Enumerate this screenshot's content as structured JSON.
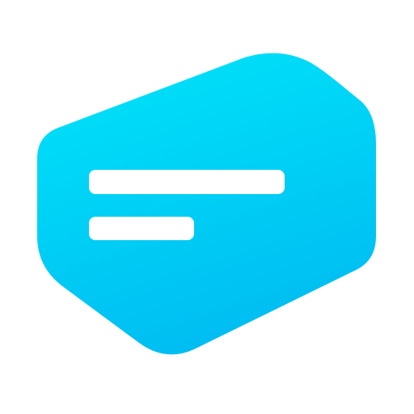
{
  "app_icon": {
    "icon_name": "message-bubble-icon",
    "colors": {
      "gradient_top": "#00E5FA",
      "gradient_bottom": "#00BEF2",
      "lines": "#FFFFFF",
      "background": "#FFFFFF"
    }
  }
}
